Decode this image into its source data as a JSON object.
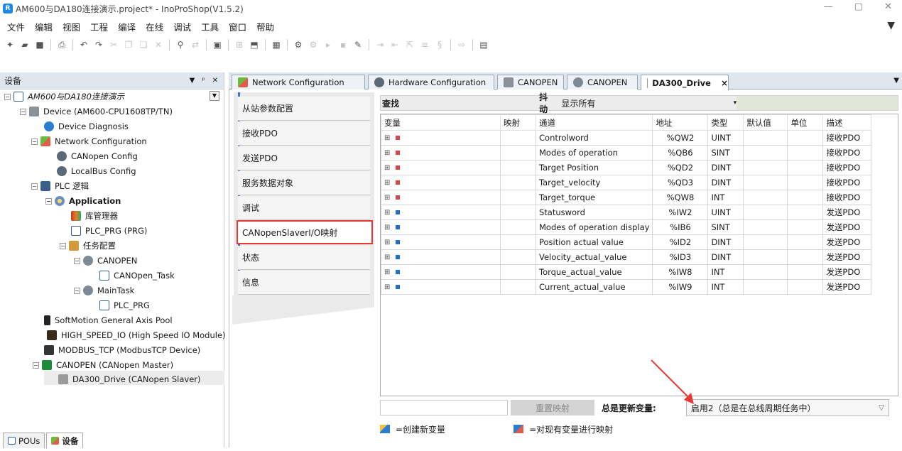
{
  "window": {
    "title": "AM600与DA180连接演示.project* - InoProShop(V1.5.2)",
    "app_icon": "R"
  },
  "menu": [
    "文件",
    "编辑",
    "视图",
    "工程",
    "编译",
    "在线",
    "调试",
    "工具",
    "窗口",
    "帮助"
  ],
  "devices_panel": {
    "title": "设备",
    "tree": [
      {
        "label": "AM600与DA180连接演示",
        "icon": "project-icon"
      },
      {
        "label": "Device (AM600-CPU1608TP/TN)",
        "icon": "device-icon"
      },
      {
        "label": "Device Diagnosis",
        "icon": "diagnosis-icon"
      },
      {
        "label": "Network Configuration",
        "icon": "network-icon"
      },
      {
        "label": "CANopen Config",
        "icon": "canopen-icon"
      },
      {
        "label": "LocalBus Config",
        "icon": "localbus-icon"
      },
      {
        "label": "PLC 逻辑",
        "icon": "plc-logic-icon"
      },
      {
        "label": "Application",
        "icon": "application-icon"
      },
      {
        "label": "库管理器",
        "icon": "library-icon"
      },
      {
        "label": "PLC_PRG (PRG)",
        "icon": "program-icon"
      },
      {
        "label": "任务配置",
        "icon": "task-config-icon"
      },
      {
        "label": "CANOPEN",
        "icon": "task-icon"
      },
      {
        "label": "CANOpen_Task",
        "icon": "task-call-icon"
      },
      {
        "label": "MainTask",
        "icon": "task-icon"
      },
      {
        "label": "PLC_PRG",
        "icon": "task-call-icon"
      },
      {
        "label": "SoftMotion General Axis Pool",
        "icon": "axis-pool-icon"
      },
      {
        "label": "HIGH_SPEED_IO (High Speed IO Module)",
        "icon": "io-module-icon"
      },
      {
        "label": "MODBUS_TCP (ModbusTCP Device)",
        "icon": "modbus-icon"
      },
      {
        "label": "CANOPEN (CANopen Master)",
        "icon": "canopen-master-icon"
      },
      {
        "label": "DA300_Drive (CANopen Slaver)",
        "icon": "drive-icon"
      }
    ],
    "bottom_tabs": [
      "POUs",
      "设备"
    ]
  },
  "editor_tabs": [
    {
      "label": "Network Configuration",
      "icon": "network-icon"
    },
    {
      "label": "Hardware Configuration",
      "icon": "hardware-icon"
    },
    {
      "label": "CANOPEN",
      "icon": "device-icon"
    },
    {
      "label": "CANOPEN",
      "icon": "task-icon"
    },
    {
      "label": "DA300_Drive",
      "icon": "drive-icon",
      "active": true,
      "close": "×"
    }
  ],
  "sidebar": {
    "items": [
      "从站参数配置",
      "接收PDO",
      "发送PDO",
      "服务数据对象",
      "调试",
      "CANopenSlaverI/O映射",
      "状态",
      "信息"
    ],
    "active_index": 5
  },
  "search": {
    "label": "查找",
    "filter_label": "抖动",
    "filter_value": "显示所有",
    "dropdown": "▾"
  },
  "table": {
    "headers": [
      "变量",
      "映射",
      "通道",
      "地址",
      "类型",
      "默认值",
      "单位",
      "描述"
    ],
    "rows": [
      {
        "dir": "out",
        "channel": "Controlword",
        "address": "%QW2",
        "type": "UINT",
        "desc": "接收PDO"
      },
      {
        "dir": "out",
        "channel": "Modes of operation",
        "address": "%QB6",
        "type": "SINT",
        "desc": "接收PDO"
      },
      {
        "dir": "out",
        "channel": "Target Position",
        "address": "%QD2",
        "type": "DINT",
        "desc": "接收PDO"
      },
      {
        "dir": "out",
        "channel": "Target_velocity",
        "address": "%QD3",
        "type": "DINT",
        "desc": "接收PDO"
      },
      {
        "dir": "out",
        "channel": "Target_torque",
        "address": "%QW8",
        "type": "INT",
        "desc": "接收PDO"
      },
      {
        "dir": "in",
        "channel": "Statusword",
        "address": "%IW2",
        "type": "UINT",
        "desc": "发送PDO"
      },
      {
        "dir": "in",
        "channel": "Modes of operation display",
        "address": "%IB6",
        "type": "SINT",
        "desc": "发送PDO"
      },
      {
        "dir": "in",
        "channel": "Position actual value",
        "address": "%ID2",
        "type": "DINT",
        "desc": "发送PDO"
      },
      {
        "dir": "in",
        "channel": "Velocity_actual_value",
        "address": "%ID3",
        "type": "DINT",
        "desc": "发送PDO"
      },
      {
        "dir": "in",
        "channel": "Torque_actual_value",
        "address": "%IW8",
        "type": "INT",
        "desc": "发送PDO"
      },
      {
        "dir": "in",
        "channel": "Current_actual_value",
        "address": "%IW9",
        "type": "INT",
        "desc": "发送PDO"
      }
    ]
  },
  "footer": {
    "reset_button": "重置映射",
    "update_label": "总是更新变量:",
    "update_value": "启用2（总是在总线周期任务中）",
    "legend_create": "=创建新变量",
    "legend_map": "=对现有变量进行映射"
  },
  "colors": {
    "highlight": "#e53935",
    "tab_strip": "#dfe6ee",
    "accent_blue": "#3a78c3"
  }
}
